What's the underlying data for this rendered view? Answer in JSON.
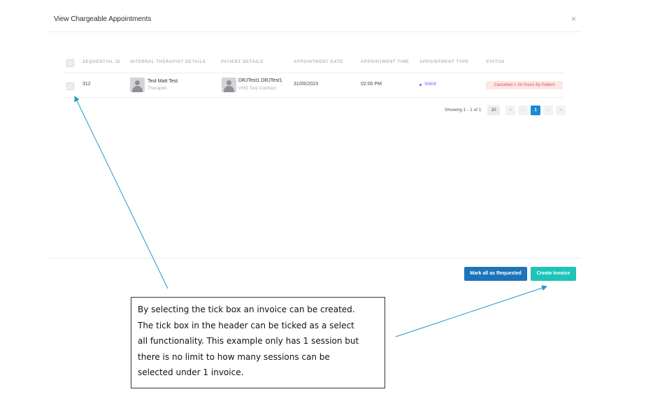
{
  "modal": {
    "title": "View Chargeable Appointments",
    "close_glyph": "×"
  },
  "table": {
    "headers": [
      "SEQUENTIAL ID",
      "INTERNAL THERAPIST DETAILS",
      "PATIENT DETAILS",
      "APPOINTMENT DATE",
      "APPOINTMENT TIME",
      "APPOINTMENT TYPE",
      "STATUS"
    ],
    "rows": [
      {
        "sequential_id": "312",
        "therapist_name": "Test Matt Test",
        "therapist_role": "Therapist",
        "patient_name": "DRJTest1 DRJTest1",
        "patient_contract": "VHG Test Contract",
        "date": "31/05/2023",
        "time": "02:00 PM",
        "type": "Voice",
        "status": "Cancelled > 24 Hours By Patient"
      }
    ]
  },
  "pagination": {
    "showing": "Showing 1 - 1 of 1",
    "per_page": "10",
    "first": "«",
    "prev": "‹",
    "current": "1",
    "next": "›",
    "last": "»"
  },
  "actions": {
    "mark_all": "Mark all as Requested",
    "create_invoice": "Create Invoice"
  },
  "callout": {
    "lines": [
      "By selecting the tick box an invoice can be created.",
      "The tick box in the header can be ticked as a select",
      "all functionality. This example only has 1 session but",
      "there is no limit to how many sessions can be",
      "selected under 1 invoice."
    ]
  },
  "colors": {
    "primary_blue": "#1d74b8",
    "teal": "#1ec4b7",
    "voice_purple": "#7b59ff",
    "status_red": "#e05252",
    "status_bg": "#fde6e6",
    "arrow": "#1f9bc9"
  }
}
